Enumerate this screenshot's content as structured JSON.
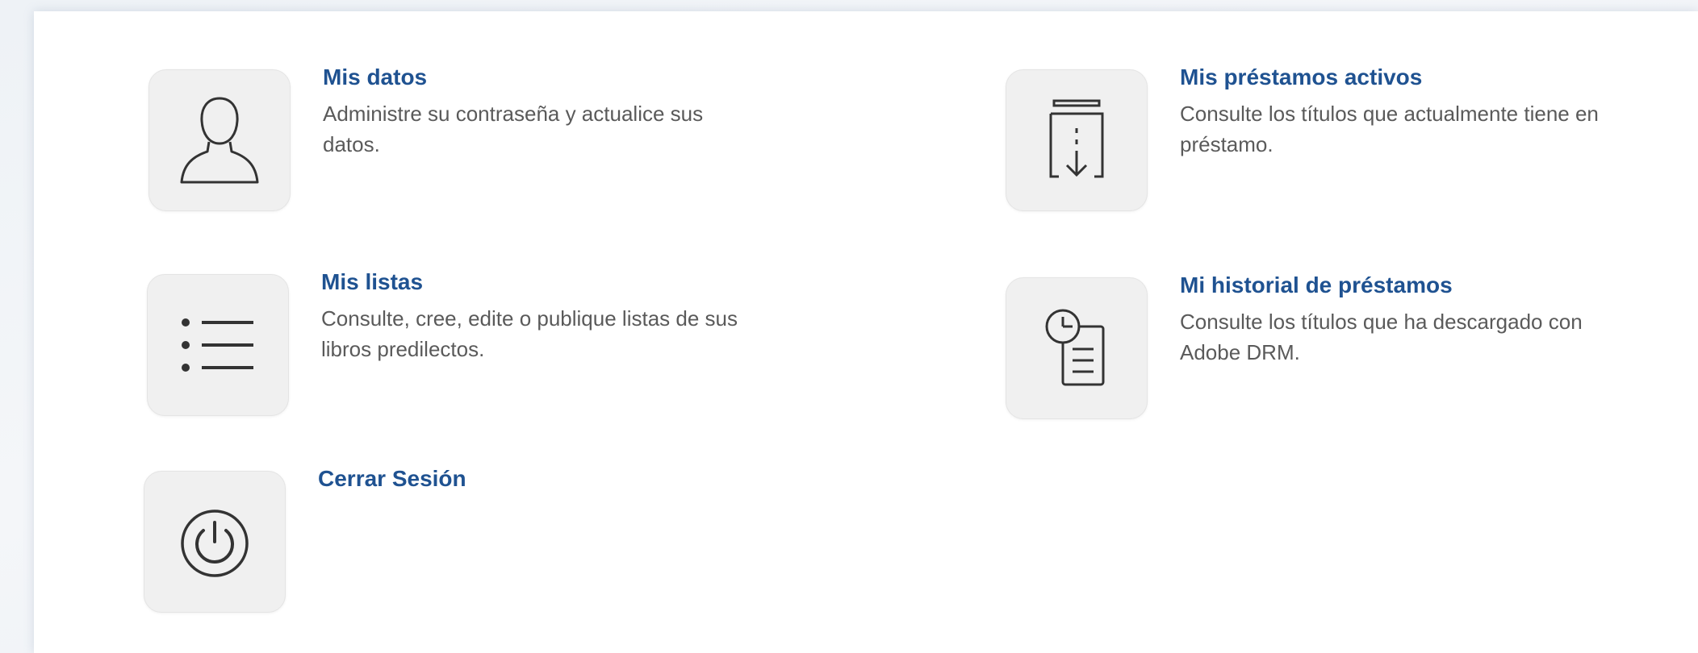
{
  "account_menu": {
    "tiles": [
      {
        "id": "mis-datos",
        "icon": "user-silhouette-icon",
        "title": "Mis datos",
        "description": "Administre su contraseña y actualice sus datos."
      },
      {
        "id": "mis-prestamos-activos",
        "icon": "book-download-icon",
        "title": "Mis préstamos activos",
        "description": "Consulte los títulos que actualmente tiene en préstamo."
      },
      {
        "id": "mis-listas",
        "icon": "bulleted-list-icon",
        "title": "Mis listas",
        "description": "Consulte, cree, edite o publique listas de sus libros predilectos."
      },
      {
        "id": "mi-historial",
        "icon": "clock-document-icon",
        "title": "Mi historial de préstamos",
        "description": "Consulte los títulos que ha descargado con Adobe DRM."
      },
      {
        "id": "cerrar-sesion",
        "icon": "power-icon",
        "title": "Cerrar Sesión",
        "description": ""
      }
    ]
  },
  "colors": {
    "title": "#1f5291",
    "description": "#5a5a5a",
    "icon_stroke": "#333333",
    "icon_bg": "#f0f0f0"
  }
}
